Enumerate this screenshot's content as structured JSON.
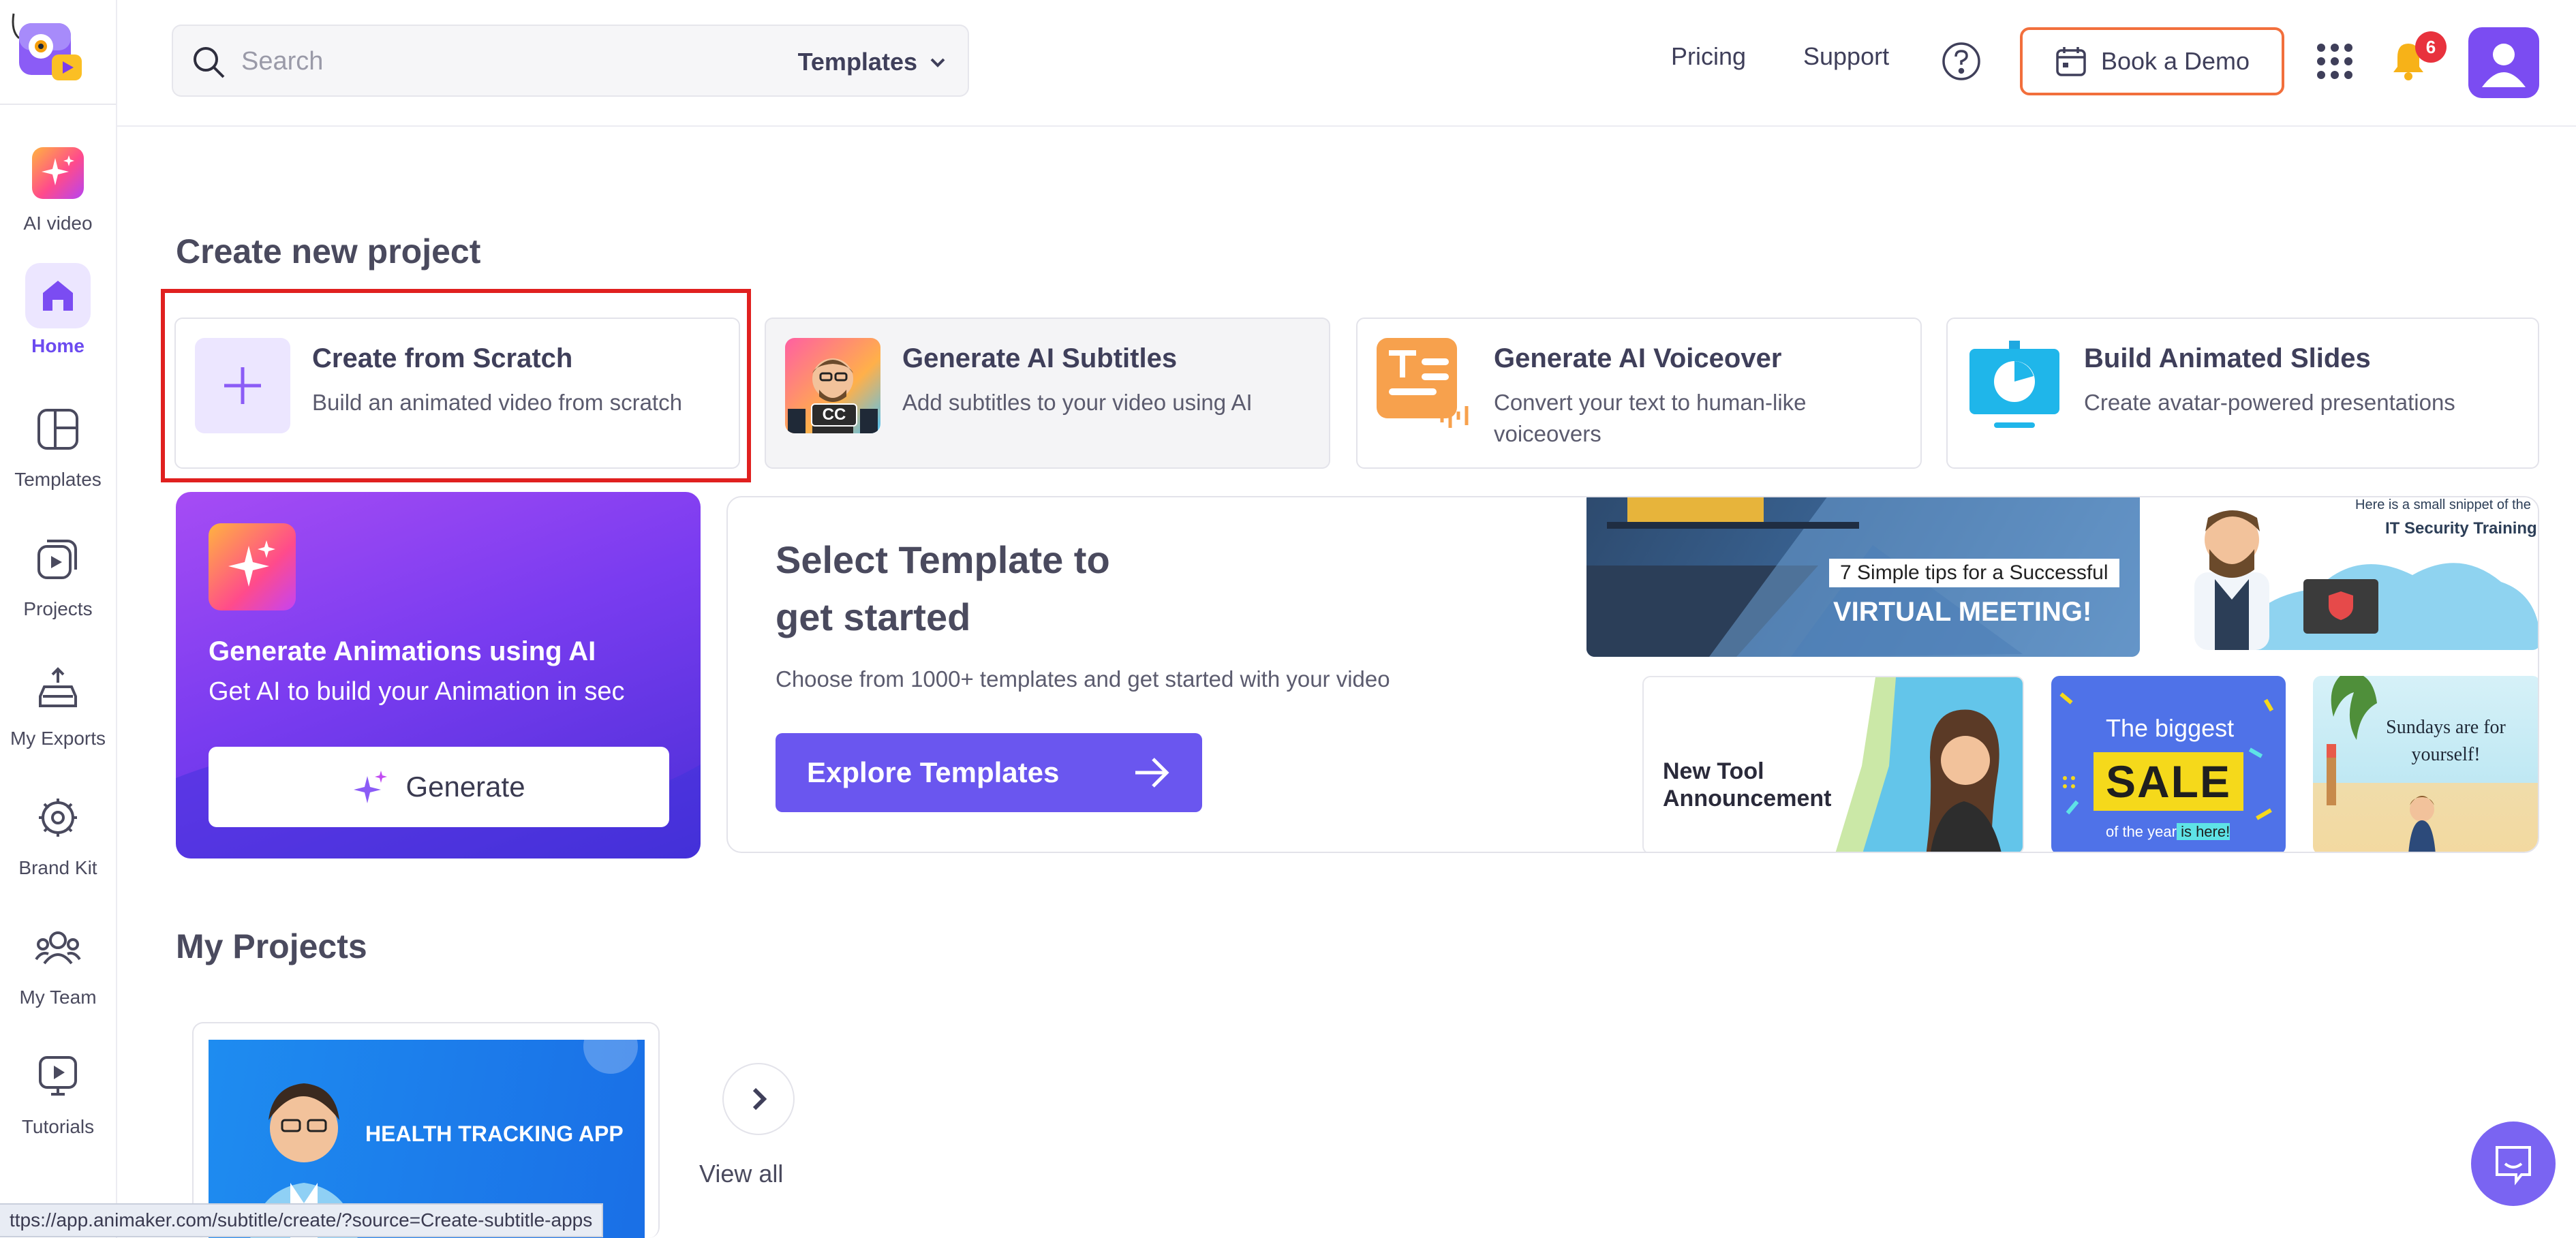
{
  "sidebar": {
    "items": [
      {
        "label": "AI video"
      },
      {
        "label": "Home"
      },
      {
        "label": "Templates"
      },
      {
        "label": "Projects"
      },
      {
        "label": "My Exports"
      },
      {
        "label": "Brand Kit"
      },
      {
        "label": "My Team"
      },
      {
        "label": "Tutorials"
      }
    ]
  },
  "header": {
    "search_placeholder": "Search",
    "search_scope": "Templates",
    "pricing": "Pricing",
    "support": "Support",
    "book_demo": "Book a Demo",
    "notification_count": "6"
  },
  "create": {
    "title": "Create new project",
    "cards": [
      {
        "title": "Create from Scratch",
        "subtitle": "Build an animated video from scratch"
      },
      {
        "title": "Generate AI Subtitles",
        "subtitle": "Add subtitles to your video using AI",
        "badge": "CC"
      },
      {
        "title": "Generate AI Voiceover",
        "subtitle": "Convert your text to human-like voiceovers"
      },
      {
        "title": "Build Animated Slides",
        "subtitle": "Create avatar-powered presentations"
      }
    ]
  },
  "ai_card": {
    "title": "Generate Animations using AI",
    "subtitle": "Get AI to build your Animation in sec",
    "button": "Generate"
  },
  "template_card": {
    "title": "Select Template to get started",
    "subtitle": "Choose from 1000+ templates and get started with your video",
    "button": "Explore Templates"
  },
  "template_tiles": {
    "virtual_meeting_caption": "7 Simple tips for a Successful",
    "virtual_meeting_title": "VIRTUAL MEETING!",
    "it_security_small": "Here is a small snippet of the",
    "it_security_title": "IT Security Training",
    "new_tool": "New Tool Announcement",
    "sale_top": "The biggest",
    "sale_main": "SALE",
    "sale_bottom_a": "of the year",
    "sale_bottom_b": " is here!",
    "sundays": "Sundays are for yourself!"
  },
  "projects": {
    "title": "My Projects",
    "items": [
      {
        "title": "HEALTH TRACKING APP"
      }
    ],
    "view_all": "View all"
  },
  "status_bar": {
    "url": "ttps://app.animaker.com/subtitle/create/?source=Create-subtitle-apps"
  },
  "colors": {
    "accent": "#6a56ef",
    "highlight": "#e0201f",
    "demo_border": "#f26f3c",
    "badge": "#e8323d"
  }
}
